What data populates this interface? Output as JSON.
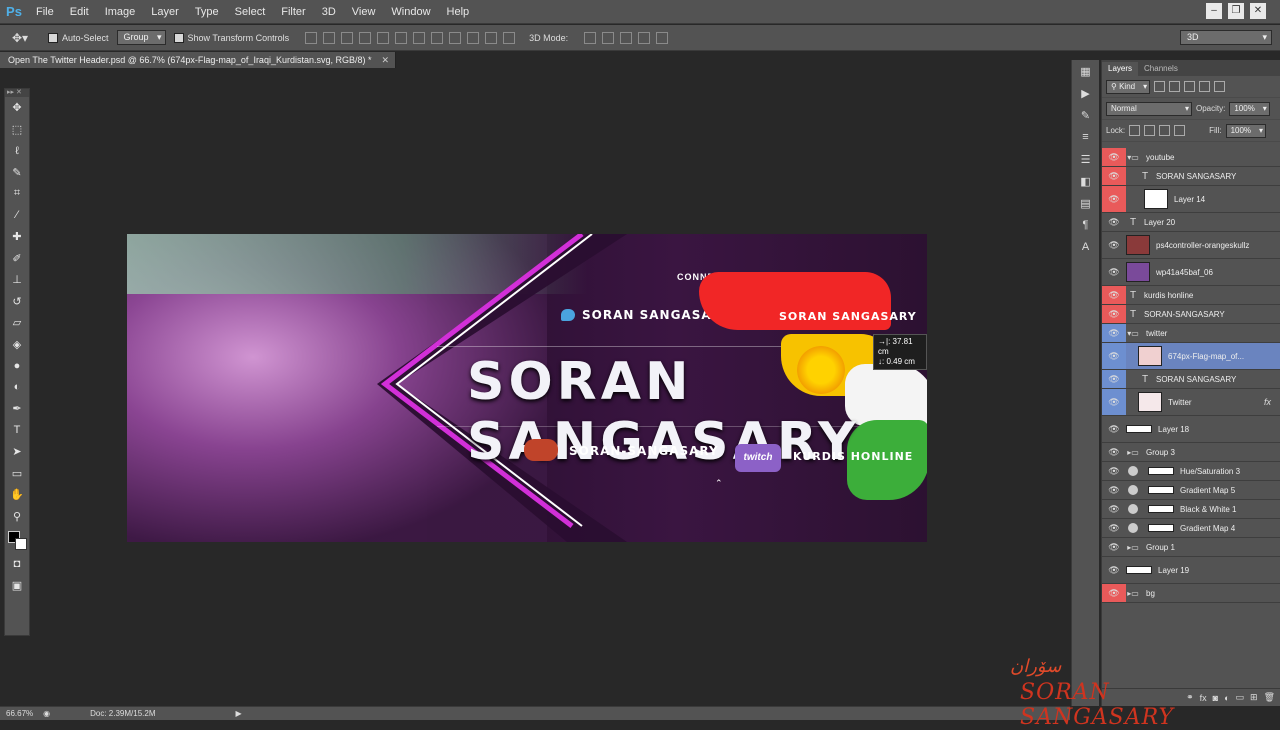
{
  "app": {
    "logo": "Ps",
    "menu": [
      "File",
      "Edit",
      "Image",
      "Layer",
      "Type",
      "Select",
      "Filter",
      "3D",
      "View",
      "Window",
      "Help"
    ]
  },
  "options": {
    "auto_select": "Auto-Select",
    "group": "Group",
    "show_transform": "Show Transform Controls",
    "mode3d": "3D Mode:",
    "workspace": "3D"
  },
  "document": {
    "tab_title": "Open The Twitter Header.psd @ 66.7% (674px-Flag-map_of_Iraqi_Kurdistan.svg, RGB/8) *"
  },
  "artwork": {
    "connect": "CONNECT WITH ME",
    "twitter_handle": "SORAN SANGASARY",
    "youtube_handle": "SORAN SANGASARY",
    "title": "SORAN SANGASARY",
    "psn_handle": "SORAN-SANGASARY",
    "twitch_logo": "twitch",
    "twitch_handle": "KURDIS HONLINE",
    "measure_x": "→|: 37.81 cm",
    "measure_y": "↓: 0.49 cm"
  },
  "panel": {
    "tabs": [
      "Layers",
      "Channels"
    ],
    "kind": "Kind",
    "blend": "Normal",
    "opacity_label": "Opacity:",
    "opacity": "100%",
    "lock_label": "Lock:",
    "fill_label": "Fill:",
    "fill": "100%",
    "layers": [
      {
        "name": "youtube",
        "type": "group",
        "eye": "red"
      },
      {
        "name": "SORAN SANGASARY",
        "type": "text",
        "eye": "red"
      },
      {
        "name": "Layer 14",
        "type": "image",
        "eye": "red"
      },
      {
        "name": "Layer 20",
        "type": "text",
        "eye": ""
      },
      {
        "name": "ps4controller-orangeskullz",
        "type": "image",
        "eye": ""
      },
      {
        "name": "wp41a45baf_06",
        "type": "image",
        "eye": ""
      },
      {
        "name": "kurdis honline",
        "type": "text",
        "eye": "red"
      },
      {
        "name": "SORAN-SANGASARY",
        "type": "text",
        "eye": "red"
      },
      {
        "name": "twitter",
        "type": "group",
        "eye": "blue"
      },
      {
        "name": "674px-Flag-map_of...",
        "type": "image",
        "eye": "blue",
        "selected": true
      },
      {
        "name": "SORAN SANGASARY",
        "type": "text",
        "eye": "blue"
      },
      {
        "name": "Twitter",
        "type": "image",
        "eye": "blue",
        "fx": "fx"
      },
      {
        "name": "Layer 18",
        "type": "bar",
        "eye": ""
      },
      {
        "name": "Group 3",
        "type": "group",
        "eye": ""
      },
      {
        "name": "Hue/Saturation 3",
        "type": "adj",
        "eye": ""
      },
      {
        "name": "Gradient Map 5",
        "type": "adj",
        "eye": ""
      },
      {
        "name": "Black & White 1",
        "type": "adj",
        "eye": ""
      },
      {
        "name": "Gradient Map 4",
        "type": "adj",
        "eye": ""
      },
      {
        "name": "Group 1",
        "type": "group",
        "eye": ""
      },
      {
        "name": "Layer 19",
        "type": "bar",
        "eye": ""
      },
      {
        "name": "bg",
        "type": "group",
        "eye": "red"
      }
    ]
  },
  "status": {
    "zoom": "66.67%",
    "doc": "Doc: 2.39M/15.2M"
  },
  "watermark": {
    "script": "سۆران",
    "name": "SORAN SANGASARY"
  }
}
